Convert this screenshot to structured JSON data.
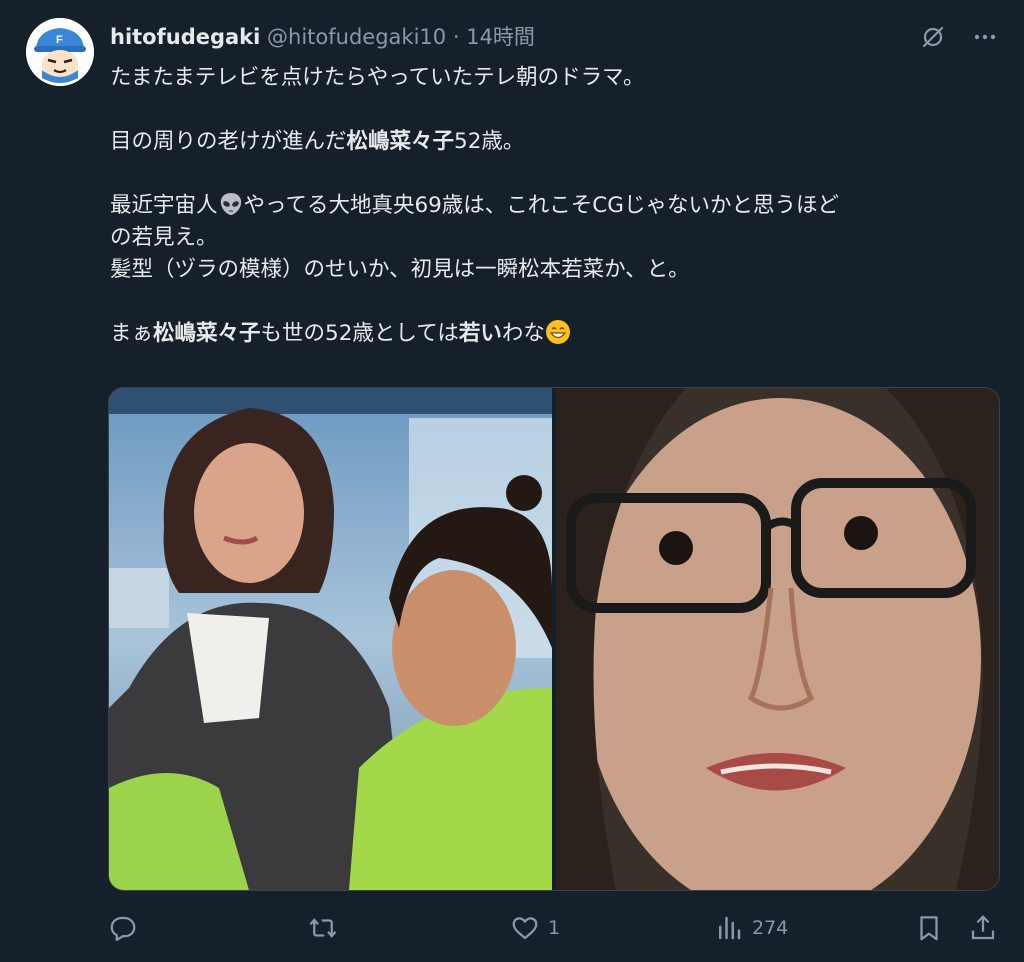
{
  "tweet": {
    "author_name": "hitofudegaki",
    "author_handle": "@hitofudegaki10",
    "separator": "·",
    "time": "14時間",
    "lines": {
      "l1": "たまたまテレビを点けたらやっていたテレ朝のドラマ。",
      "l2_pre": "目の周りの老けが進んだ",
      "l2_bold": "松嶋菜々子",
      "l2_post": "52歳。",
      "l3_pre": "最近宇宙人",
      "l3_post": "やってる大地真央69歳は、これこそCGじゃないかと思うほど",
      "l4": "の若見え。",
      "l5": "髪型（ヅラの模様）のせいか、初見は一瞬松本若菜か、と。",
      "l6_pre": "まぁ",
      "l6_bold": "松嶋菜々子",
      "l6_mid": "も世の52歳としては",
      "l6_bold2": "若い",
      "l6_post": "わな"
    },
    "emojis": {
      "alien": "alien-emoji",
      "grin": "grinning-emoji"
    }
  },
  "actions": {
    "reply_count": "",
    "retweet_count": "",
    "like_count": "1",
    "views_count": "274"
  },
  "icons": {
    "avatar": "avatar-icon",
    "grok": "grok-icon",
    "more": "more-icon",
    "reply": "reply-icon",
    "retweet": "retweet-icon",
    "like": "heart-icon",
    "views": "views-icon",
    "bookmark": "bookmark-icon",
    "share": "share-icon"
  },
  "colors": {
    "background": "#15202b",
    "text": "#e7e9ea",
    "secondary": "#8b98a5"
  }
}
